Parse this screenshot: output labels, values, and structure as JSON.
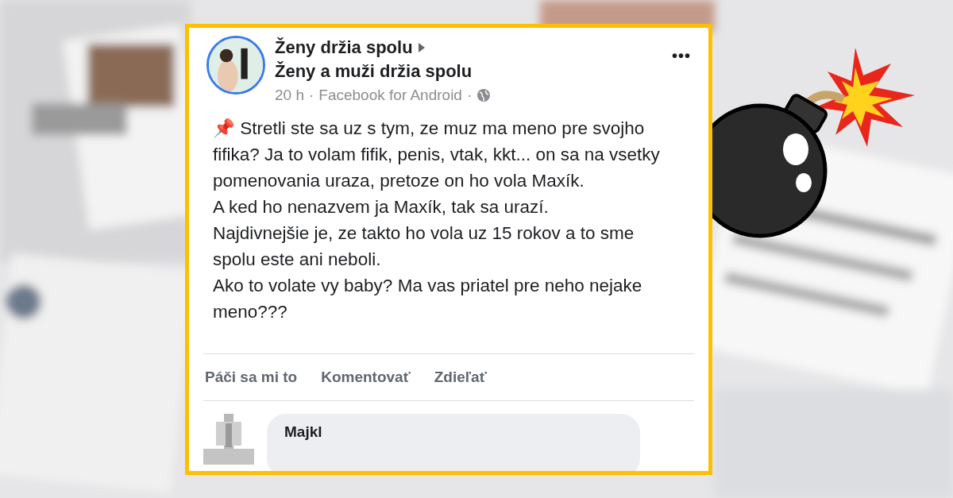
{
  "post": {
    "group": "Ženy držia spolu",
    "target": "Ženy a muži držia spolu",
    "time": "20 h",
    "source": "Facebook for Android",
    "menu": "•••",
    "separator": "·",
    "paragraphs": [
      "📌 Stretli ste sa uz s tym, ze muz ma meno pre svojho fifika? Ja to volam fifik, penis, vtak, kkt... on sa na vsetky pomenovania uraza, pretoze on ho vola Maxík.",
      "A ked ho nenazvem ja Maxík, tak sa urazí.",
      "Najdivnejšie je, ze takto ho vola uz 15 rokov a to sme spolu este ani neboli.",
      "Ako to volate vy baby? Ma vas priatel pre neho nejake meno???"
    ],
    "actions": [
      "Páči sa mi to",
      "Komentovať",
      "Zdieľať"
    ],
    "comment": {
      "author": "Majkl"
    }
  }
}
